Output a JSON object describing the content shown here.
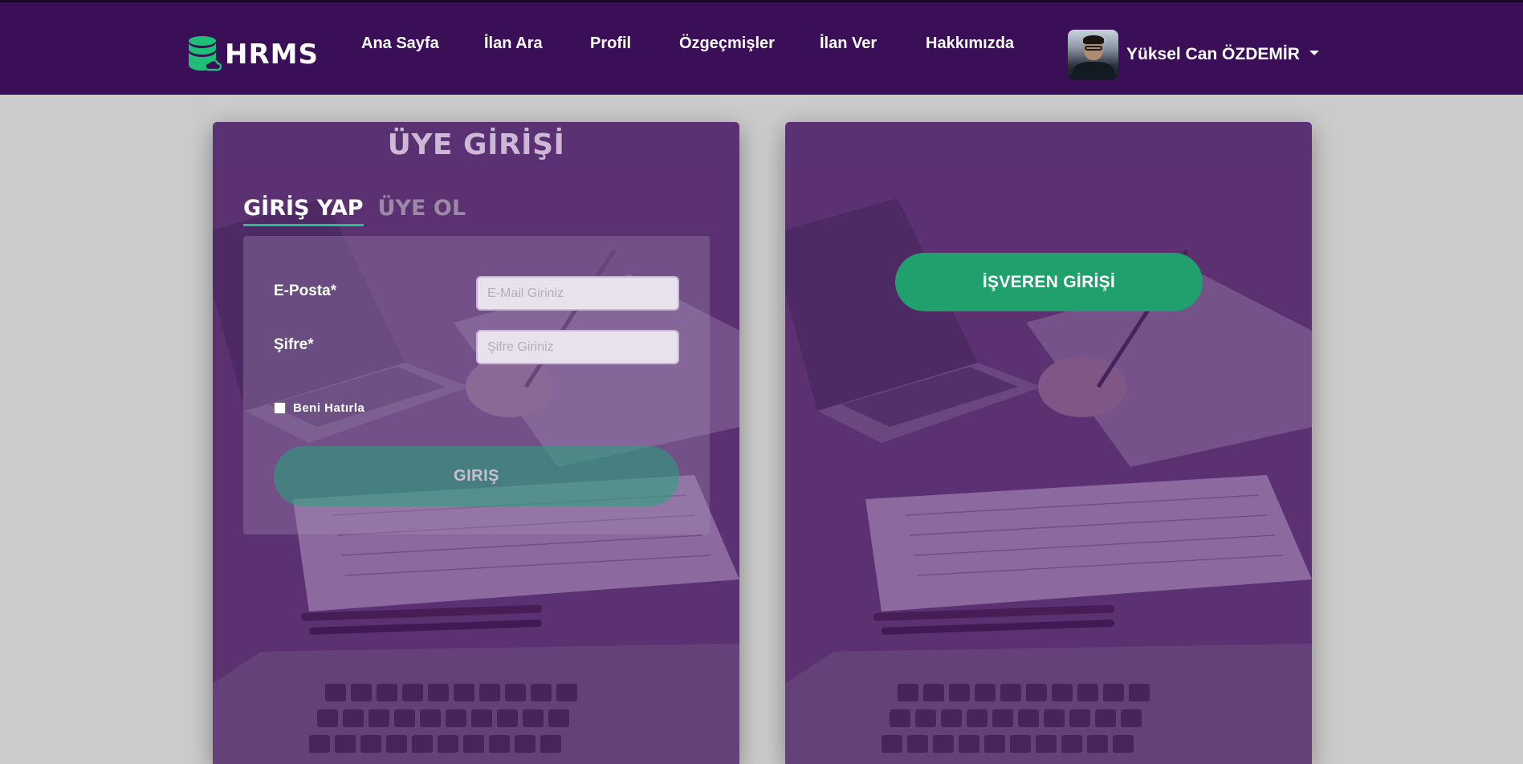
{
  "brand": {
    "name": "HRMS",
    "icon": "database-cloud-icon",
    "icon_color": "#1fbf7a"
  },
  "nav": {
    "links": [
      "Ana Sayfa",
      "İlan Ara",
      "Profil",
      "Özgeçmişler",
      "İlan Ver",
      "Hakkımızda"
    ]
  },
  "user": {
    "name": "Yüksel Can ÖZDEMİR",
    "avatar": "user-avatar",
    "menu_icon": "caret-down-icon"
  },
  "login_card": {
    "title": "ÜYE GİRİŞİ",
    "tabs": [
      {
        "label": "GİRİŞ YAP",
        "active": true
      },
      {
        "label": "ÜYE OL",
        "active": false
      }
    ],
    "fields": [
      {
        "label": "E-Posta*",
        "placeholder": "E-Mail Giriniz",
        "value": ""
      },
      {
        "label": "Şifre*",
        "placeholder": "Şifre Giriniz",
        "value": ""
      }
    ],
    "remember_label": "Beni Hatırla",
    "remember_checked": false,
    "submit_label": "GIRIŞ"
  },
  "employer_card": {
    "button_label": "İŞVEREN GİRİŞİ"
  },
  "colors": {
    "navbar": "#3b0f57",
    "accent_green": "#1fa06c",
    "page_background": "#cbcbcb"
  }
}
